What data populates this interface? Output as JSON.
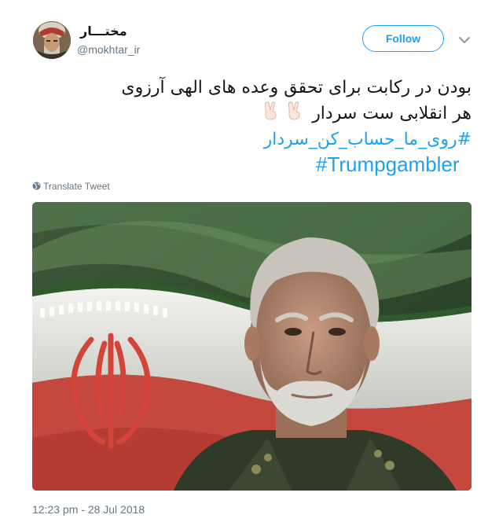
{
  "author": {
    "display_name": "مختـــار",
    "handle": "@mokhtar_ir",
    "avatar_icon": "avatar-portrait"
  },
  "follow_button": {
    "label": "Follow"
  },
  "menu": {
    "icon": "chevron-down-icon"
  },
  "tweet": {
    "line1": "بودن در رکابت برای تحقق وعده های الهی آرزوی",
    "line2": "هر انقلابی ست سردار",
    "emoji": [
      "victory-hand-icon",
      "victory-hand-icon"
    ],
    "hashtags": [
      "#روی_ما_حساب_کن_سردار",
      "#Trumpgambler"
    ]
  },
  "translate": {
    "label": "Translate Tweet",
    "icon": "globe-icon"
  },
  "media": {
    "kind": "photo"
  },
  "timestamp": "12:23 pm - 28 Jul 2018",
  "colors": {
    "link": "#1da1f2",
    "text": "#14171a",
    "muted": "#657786"
  }
}
